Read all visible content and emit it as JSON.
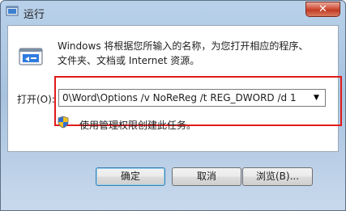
{
  "window": {
    "title": "运行",
    "close_glyph": "✕"
  },
  "dialog": {
    "description_line1": "Windows 将根据您所输入的名称，为您打开相应的程序、",
    "description_line2": "文件夹、文档或 Internet 资源。",
    "open_label": "打开(O):",
    "command_value": "0\\Word\\Options /v NoReReg /t REG_DWORD /d 1",
    "admin_note": "使用管理权限创建此任务。"
  },
  "buttons": {
    "ok": "确定",
    "cancel": "取消",
    "browse": "浏览(B)..."
  },
  "colors": {
    "highlight": "#e11b1b",
    "titlebar": "#b9d1ea",
    "close": "#c13b23"
  },
  "icons": {
    "title": "run-dialog-icon",
    "run": "run-program-icon",
    "shield": "uac-shield-icon",
    "combo": "chevron-down-icon"
  }
}
